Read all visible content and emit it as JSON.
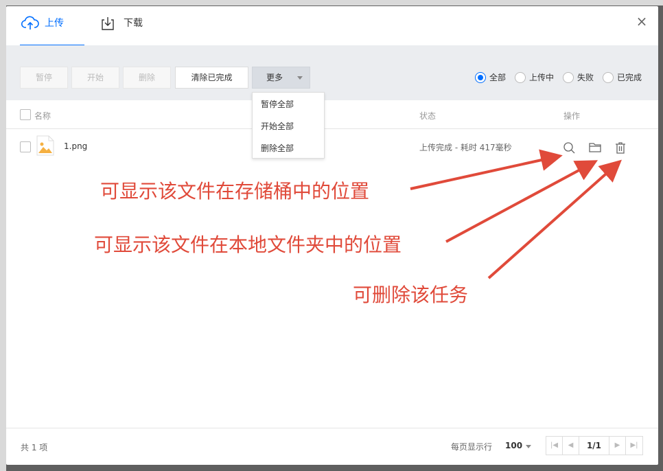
{
  "tabs": [
    {
      "label": "上传",
      "icon": "cloud-upload-icon",
      "active": true
    },
    {
      "label": "下载",
      "icon": "download-icon",
      "active": false
    }
  ],
  "close_icon": "×",
  "toolbar": {
    "pause": "暂停",
    "start": "开始",
    "delete": "删除",
    "clear_completed": "清除已完成",
    "more": "更多"
  },
  "more_menu": [
    "暂停全部",
    "开始全部",
    "删除全部"
  ],
  "filters": [
    {
      "label": "全部",
      "checked": true
    },
    {
      "label": "上传中",
      "checked": false
    },
    {
      "label": "失败",
      "checked": false
    },
    {
      "label": "已完成",
      "checked": false
    }
  ],
  "table": {
    "headers": {
      "name": "名称",
      "status": "状态",
      "ops": "操作"
    },
    "rows": [
      {
        "name": "1.png",
        "status": "上传完成 - 耗时 417毫秒"
      }
    ]
  },
  "annotations": {
    "bucket_location": "可显示该文件在存储桶中的位置",
    "local_location": "可显示该文件在本地文件夹中的位置",
    "delete_task": "可删除该任务"
  },
  "footer": {
    "total": "共 1 项",
    "per_page_label": "每页显示行",
    "per_page_value": "100",
    "page": "1/1"
  },
  "colors": {
    "accent": "#006eff",
    "annotation": "#e04a3a"
  }
}
